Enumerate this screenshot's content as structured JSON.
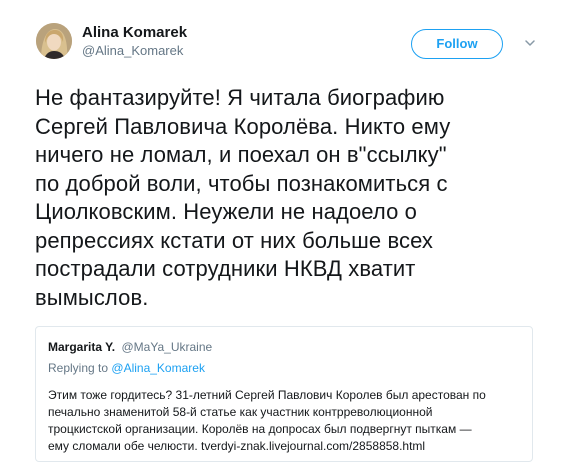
{
  "tweet": {
    "author": {
      "display_name": "Alina Komarek",
      "handle": "@Alina_Komarek",
      "avatar_icon": "avatar-photo"
    },
    "follow_label": "Follow",
    "caret_icon": "chevron-down-icon",
    "text": "Не фантазируйте! Я читала биографию\nСергей Павловича Королёва. Никто ему\nничего не ломал, и поехал он в\"ссылку\"\nпо доброй воли, чтобы познакомиться с\nЦиолковским. Неужели не надоело о\nрепрессиях кстати от них больше всех\nпострадали сотрудники НКВД хватит\nвымыслов."
  },
  "quoted_tweet": {
    "display_name": "Margarita Y.",
    "handle": "@MaYa_Ukraine",
    "replying_prefix": "Replying to",
    "replying_to": "@Alina_Komarek",
    "text": "Этим тоже гордитесь?   31-летний Сергей Павлович Королев был арестован по\nпечально знаменитой 58-й статье как участник контрреволюционной\nтроцкистской организации. Королёв на допросах был подвергнут пыткам —\nему сломали обе челюсти. tverdyi-znak.livejournal.com/2858858.html"
  },
  "colors": {
    "accent": "#1da1f2",
    "text_primary": "#14171a",
    "text_secondary": "#657786",
    "border": "#e1e8ed"
  }
}
